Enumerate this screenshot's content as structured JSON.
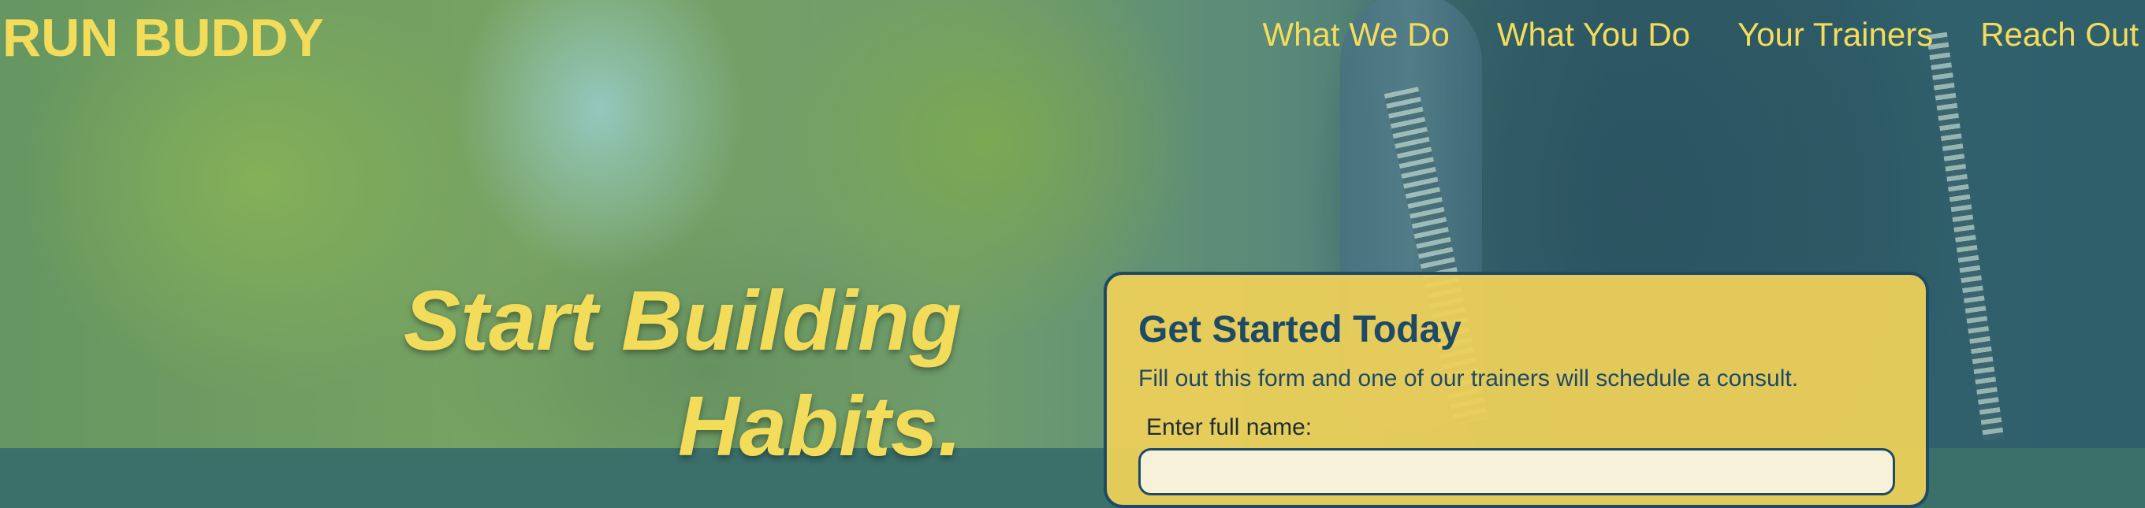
{
  "brand": {
    "name": "RUN BUDDY"
  },
  "nav": {
    "items": [
      {
        "label": "What We Do"
      },
      {
        "label": "What You Do"
      },
      {
        "label": "Your Trainers"
      },
      {
        "label": "Reach Out"
      }
    ]
  },
  "hero": {
    "headline_line1": "Start Building",
    "headline_line2": "Habits."
  },
  "signup_form": {
    "title": "Get Started Today",
    "subtitle": "Fill out this form and one of our trainers will schedule a consult.",
    "name_label": "Enter full name:",
    "name_value": ""
  },
  "colors": {
    "brand_yellow": "#f4dc5b",
    "navy": "#1f4a66",
    "card_yellow": "#ecd05a"
  }
}
